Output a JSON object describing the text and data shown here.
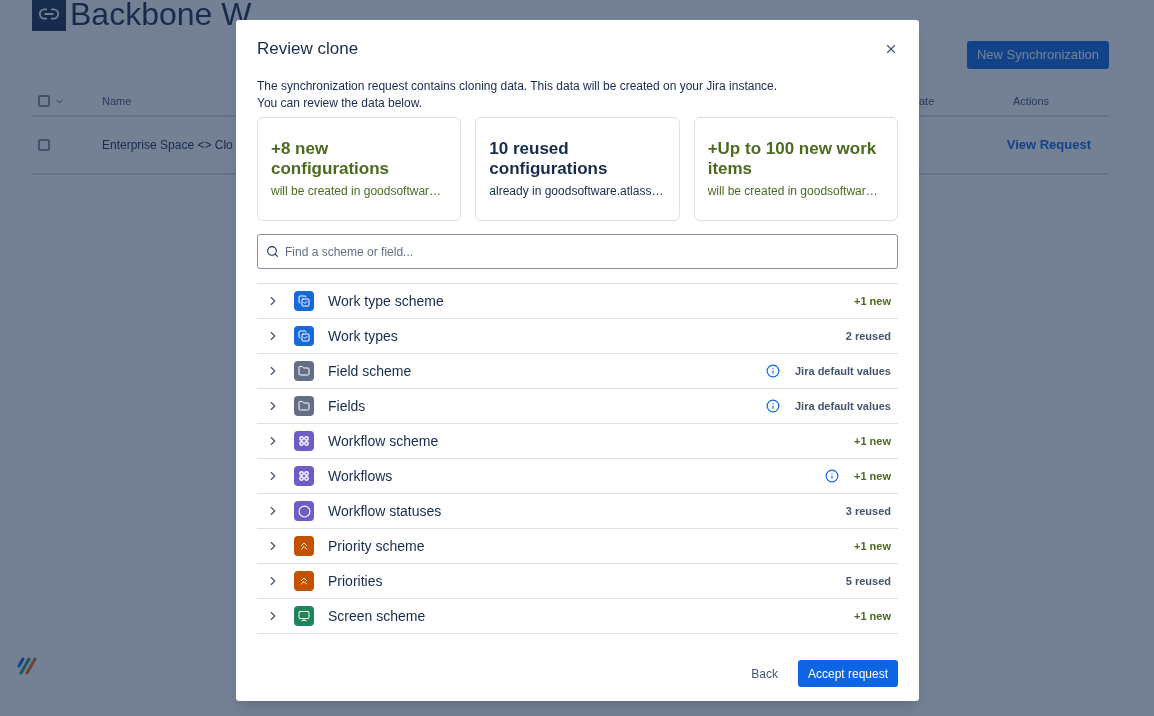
{
  "app": {
    "title": "Backbone W",
    "new_button": "New Synchronization"
  },
  "table": {
    "columns": [
      "Name",
      "ate",
      "Actions"
    ],
    "rows": [
      {
        "name": "Enterprise Space <> Clo",
        "action": "View Request",
        "checked": false
      }
    ],
    "all_checked": false
  },
  "dialog": {
    "title": "Review clone",
    "intro": [
      "The synchronization request contains cloning data. This data will be created on your Jira instance.",
      "You can review the data below."
    ],
    "cards": [
      {
        "kind": "new",
        "headline": "+8 new configurations",
        "detail": "will be created in goodsoftwar…"
      },
      {
        "kind": "reused",
        "headline": "10 reused configurations",
        "detail": "already in goodsoftware.atlass…"
      },
      {
        "kind": "new",
        "headline": "+Up to 100 new work items",
        "detail": "will be created in goodsoftwar…"
      }
    ],
    "search": {
      "placeholder": "Find a scheme or field..."
    },
    "items": [
      {
        "kind": "work-type",
        "label": "Work type scheme",
        "info": false,
        "status": {
          "kind": "new",
          "text": "+1 new"
        },
        "expanded": false
      },
      {
        "kind": "work-type",
        "label": "Work types",
        "info": false,
        "status": {
          "kind": "reused",
          "text": "2 reused"
        },
        "expanded": false
      },
      {
        "kind": "field",
        "label": "Field scheme",
        "info": true,
        "status": {
          "kind": "reused",
          "text": "Jira default values"
        },
        "expanded": false
      },
      {
        "kind": "field",
        "label": "Fields",
        "info": true,
        "status": {
          "kind": "reused",
          "text": "Jira default values"
        },
        "expanded": false
      },
      {
        "kind": "workflow",
        "label": "Workflow scheme",
        "info": false,
        "status": {
          "kind": "new",
          "text": "+1 new"
        },
        "expanded": false
      },
      {
        "kind": "workflow",
        "label": "Workflows",
        "info": true,
        "status": {
          "kind": "new",
          "text": "+1 new"
        },
        "expanded": false
      },
      {
        "kind": "status",
        "label": "Workflow statuses",
        "info": false,
        "status": {
          "kind": "reused",
          "text": "3 reused"
        },
        "expanded": false
      },
      {
        "kind": "priority",
        "label": "Priority scheme",
        "info": false,
        "status": {
          "kind": "new",
          "text": "+1 new"
        },
        "expanded": false
      },
      {
        "kind": "priority",
        "label": "Priorities",
        "info": false,
        "status": {
          "kind": "reused",
          "text": "5 reused"
        },
        "expanded": false
      },
      {
        "kind": "screen",
        "label": "Screen scheme",
        "info": false,
        "status": {
          "kind": "new",
          "text": "+1 new"
        },
        "expanded": false
      }
    ],
    "buttons": {
      "back": "Back",
      "accept": "Accept request"
    }
  }
}
